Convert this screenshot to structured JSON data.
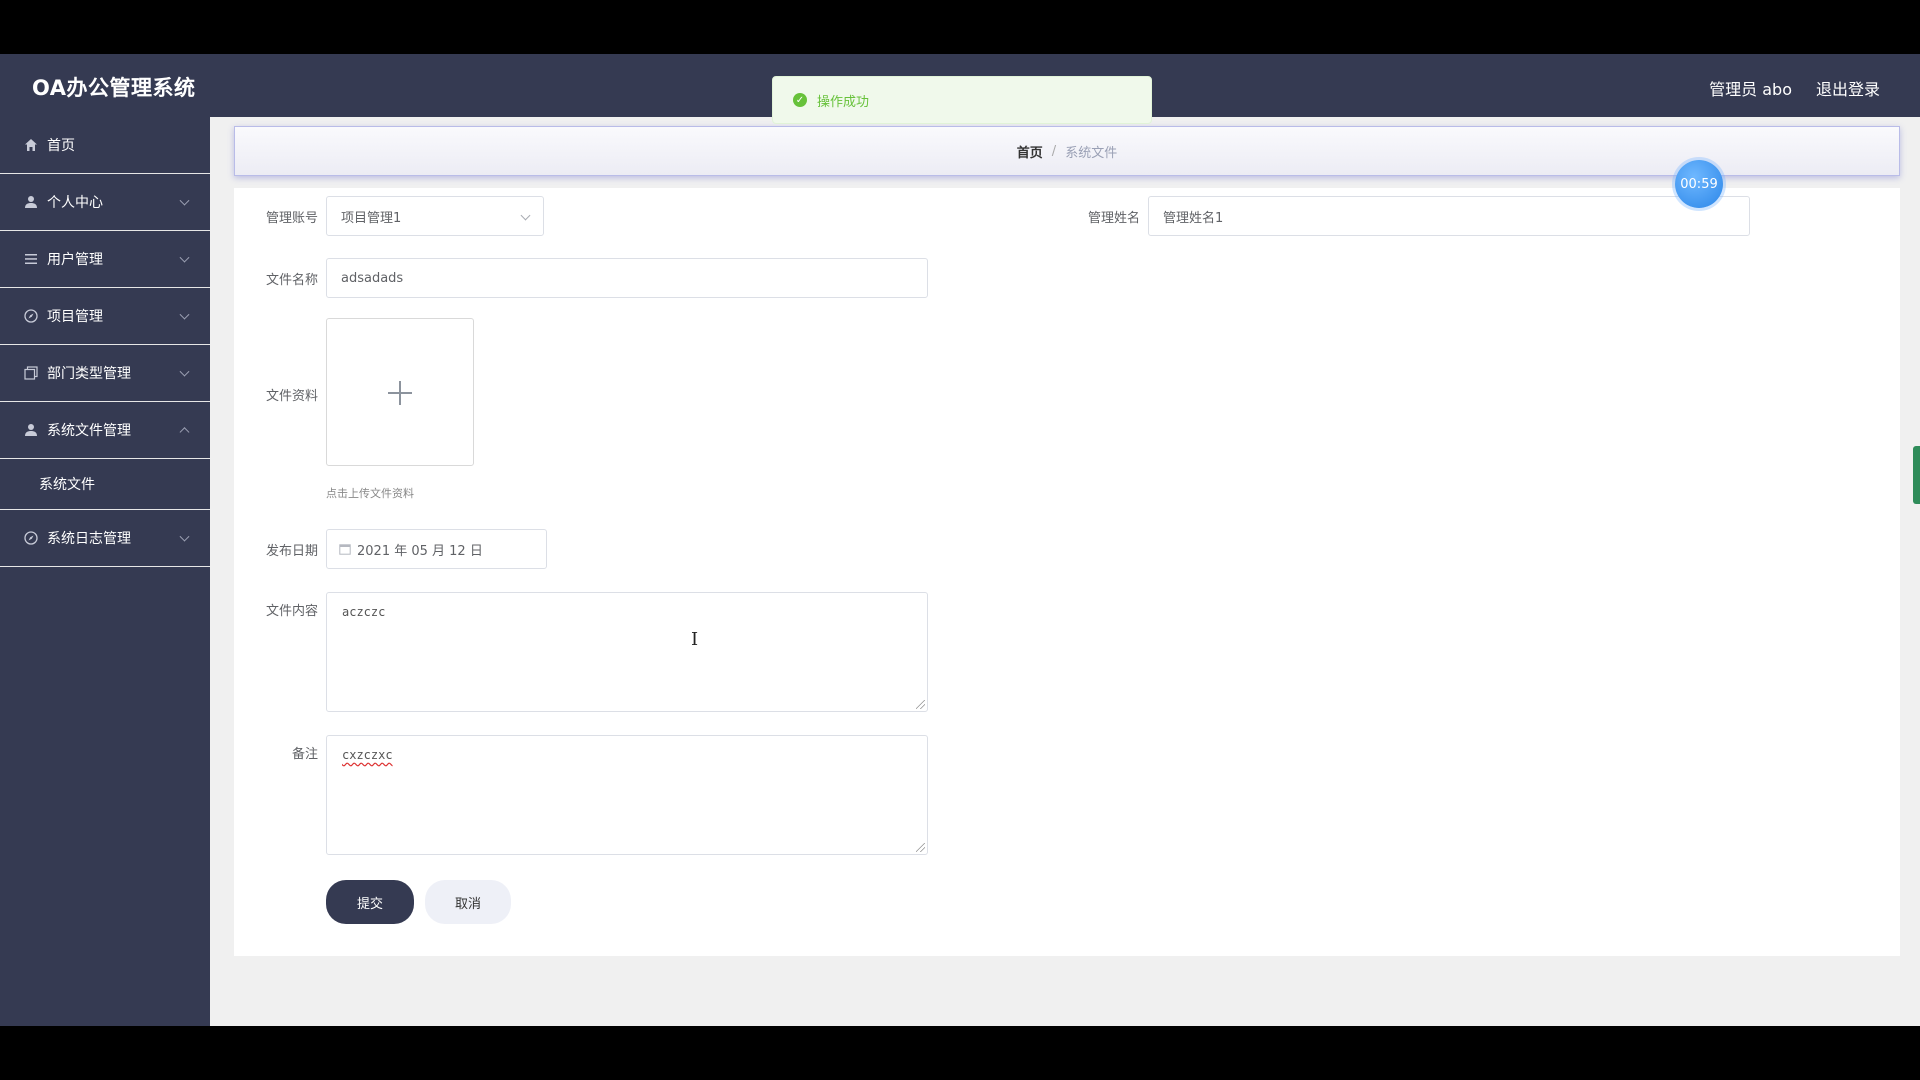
{
  "app": {
    "title": "OA办公管理系统"
  },
  "header": {
    "user_label": "管理员 abo",
    "logout_label": "退出登录"
  },
  "toast": {
    "message": "操作成功",
    "icon": "check-circle-icon",
    "color": "#67c23a"
  },
  "timer": {
    "text": "00:59"
  },
  "sidebar": {
    "items": [
      {
        "label": "首页",
        "icon": "home-icon"
      },
      {
        "label": "个人中心",
        "icon": "user-icon"
      },
      {
        "label": "用户管理",
        "icon": "list-icon"
      },
      {
        "label": "项目管理",
        "icon": "compass-icon"
      },
      {
        "label": "部门类型管理",
        "icon": "copy-icon"
      },
      {
        "label": "系统文件管理",
        "icon": "user-icon",
        "expanded": true,
        "children": [
          {
            "label": "系统文件"
          }
        ]
      },
      {
        "label": "系统日志管理",
        "icon": "compass-icon"
      }
    ]
  },
  "breadcrumb": {
    "home": "首页",
    "separator": "/",
    "current": "系统文件"
  },
  "form": {
    "account": {
      "label": "管理账号",
      "value": "项目管理1"
    },
    "name": {
      "label": "管理姓名",
      "value": "管理姓名1"
    },
    "file_name": {
      "label": "文件名称",
      "value": "adsadads"
    },
    "file_upload": {
      "label": "文件资料",
      "hint": "点击上传文件资料"
    },
    "date": {
      "label": "发布日期",
      "value": "2021 年 05 月 12 日"
    },
    "content": {
      "label": "文件内容",
      "value": "aczczc"
    },
    "remark": {
      "label": "备注",
      "value": "cxzczxc"
    },
    "submit_label": "提交",
    "cancel_label": "取消"
  },
  "colors": {
    "sidebar_bg": "#353a52",
    "accent": "#353a52"
  }
}
